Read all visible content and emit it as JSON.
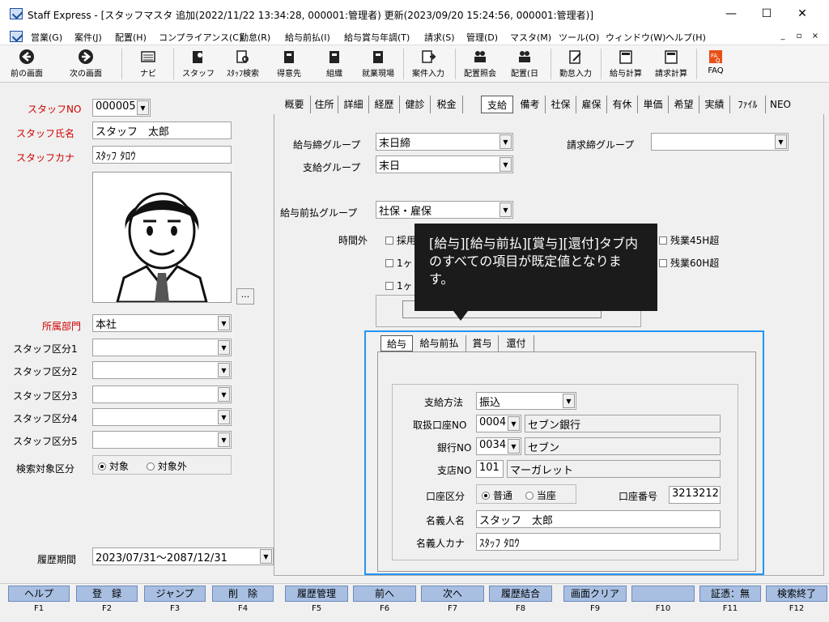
{
  "window": {
    "title": "Staff Express - [スタッフマスタ 追加(2022/11/22 13:34:28, 000001:管理者) 更新(2023/09/20 15:24:56, 000001:管理者)]",
    "minimize": "—",
    "maximize": "☐",
    "close": "✕"
  },
  "menu": {
    "items": [
      "営業(G)",
      "案件(J)",
      "配置(H)",
      "コンプライアンス(C)",
      "勤怠(R)",
      "給与前払(I)",
      "給与賞与年調(T)",
      "請求(S)",
      "管理(D)",
      "マスタ(M)",
      "ツール(O)",
      "ウィンドウ(W)",
      "ヘルプ(H)"
    ],
    "mdi": [
      "_",
      "▫",
      "×"
    ]
  },
  "toolbar": {
    "items": [
      "前の画面",
      "次の画面",
      "ナビ",
      "スタッフ",
      "ｽﾀｯﾌ検索",
      "得意先",
      "組織",
      "就業現場",
      "案件入力",
      "配置照会",
      "配置(日",
      "勤怠入力",
      "給与計算",
      "請求計算",
      "FAQ"
    ]
  },
  "left": {
    "staff_no_label": "スタッフNO",
    "staff_no": "000005",
    "staff_name_label": "スタッフ氏名",
    "staff_name": "スタッフ　太郎",
    "staff_kana_label": "スタッフカナ",
    "staff_kana": "ｽﾀｯﾌ ﾀﾛｳ",
    "photo_btn": "...",
    "dept_label": "所属部門",
    "dept": "本社",
    "class_labels": [
      "スタッフ区分1",
      "スタッフ区分2",
      "スタッフ区分3",
      "スタッフ区分4",
      "スタッフ区分5"
    ],
    "search_label": "検索対象区分",
    "search_opt1": "対象",
    "search_opt2": "対象外",
    "history_label": "履歴期間",
    "history_value": "2023/07/31～2087/12/31"
  },
  "tabs": [
    "概要",
    "住所",
    "詳細",
    "経歴",
    "健診",
    "税金",
    "支給",
    "備考",
    "社保",
    "雇保",
    "有休",
    "単価",
    "希望",
    "実績",
    "ﾌｧｲﾙ",
    "NEO"
  ],
  "pay": {
    "closing_label": "給与締グループ",
    "closing": "末日締",
    "payment_label": "支給グループ",
    "payment": "末日",
    "billing_label": "請求締グループ",
    "billing": "",
    "advance_label": "給与前払グループ",
    "advance": "社保・雇保",
    "overtime_label": "時間外",
    "ot_opts": [
      "採用",
      "1ヶ",
      "1ヶ"
    ],
    "ot_45": "残業45H超",
    "ot_60": "残業60H超"
  },
  "tooltip": {
    "text": "[給与][給与前払][賞与][還付]タブ内のすべての項目が既定値となります。"
  },
  "subtabs": [
    "給与",
    "給与前払",
    "賞与",
    "還付"
  ],
  "bank": {
    "method_label": "支給方法",
    "method": "振込",
    "bank_code_label": "取扱口座NO",
    "bank_code": "0004",
    "bank_code_name": "セブン銀行",
    "bank_no_label": "銀行NO",
    "bank_no": "0034",
    "bank_no_name": "セブン",
    "branch_label": "支店NO",
    "branch_no": "101",
    "branch_name": "マーガレット",
    "acct_type_label": "口座区分",
    "acct_type_opt1": "普通",
    "acct_type_opt2": "当座",
    "acct_no_label": "口座番号",
    "acct_no": "3213212",
    "holder_label": "名義人名",
    "holder": "スタッフ　太郎",
    "holder_kana_label": "名義人カナ",
    "holder_kana": "ｽﾀｯﾌ ﾀﾛｳ"
  },
  "fkeys": [
    {
      "label": "ヘルプ",
      "key": "F1"
    },
    {
      "label": "登　録",
      "key": "F2"
    },
    {
      "label": "ジャンプ",
      "key": "F3"
    },
    {
      "label": "削　除",
      "key": "F4"
    },
    {
      "label": "履歴管理",
      "key": "F5"
    },
    {
      "label": "前へ",
      "key": "F6"
    },
    {
      "label": "次へ",
      "key": "F7"
    },
    {
      "label": "履歴結合",
      "key": "F8"
    },
    {
      "label": "画面クリア",
      "key": "F9"
    },
    {
      "label": "",
      "key": "F10"
    },
    {
      "label": "証憑：無",
      "key": "F11"
    },
    {
      "label": "検索終了",
      "key": "F12"
    }
  ],
  "colors": {
    "accent": "#2196f3",
    "fkey": "#a8bfe2",
    "required_label": "#d00000",
    "tooltip_bg": "#1b1b1b"
  }
}
